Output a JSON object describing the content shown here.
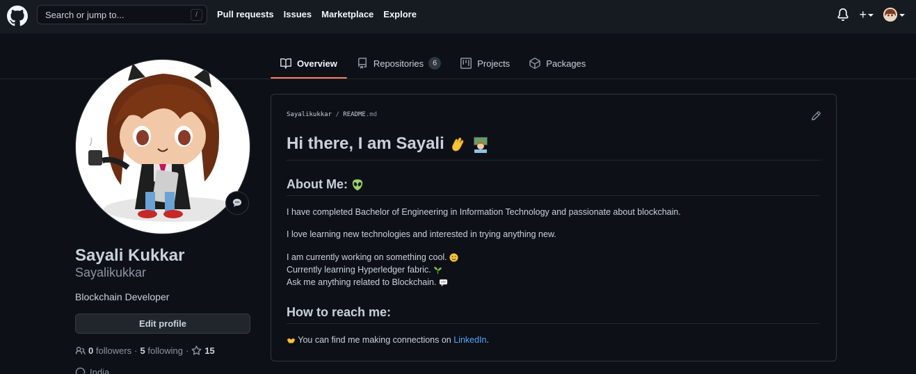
{
  "header": {
    "search_placeholder": "Search or jump to...",
    "search_shortcut": "/",
    "nav": [
      "Pull requests",
      "Issues",
      "Marketplace",
      "Explore"
    ],
    "plus": "+"
  },
  "tabs": [
    {
      "label": "Overview",
      "icon": "book-icon",
      "active": true
    },
    {
      "label": "Repositories",
      "icon": "repo-icon",
      "count": "6"
    },
    {
      "label": "Projects",
      "icon": "project-icon"
    },
    {
      "label": "Packages",
      "icon": "package-icon"
    }
  ],
  "profile": {
    "full_name": "Sayali Kukkar",
    "login": "Sayalikukkar",
    "bio": "Blockchain Developer",
    "edit_label": "Edit profile",
    "followers_count": "0",
    "followers_label": "followers",
    "following_count": "5",
    "following_label": "following",
    "stars_count": "15",
    "location_partial": "India"
  },
  "readme": {
    "owner": "Sayalikukkar",
    "separator": "/",
    "file": "README",
    "ext": ".md",
    "heading": "Hi there, I am Sayali",
    "about_heading": "About Me:",
    "para1": "I have completed Bachelor of Engineering in Information Technology and passionate about blockchain.",
    "para2": "I love learning new technologies and interested in trying anything new.",
    "line1": "I am currently working on something cool.",
    "line2": "Currently learning Hyperledger fabric.",
    "line3": "Ask me anything related to Blockchain.",
    "reach_heading": "How to reach me:",
    "reach_text": "You can find me making connections on",
    "reach_link": "LinkedIn",
    "reach_end": "."
  },
  "colors": {
    "background": "#0d1117",
    "header": "#161b22",
    "accent_tab": "#f78166",
    "link": "#58a6ff"
  }
}
